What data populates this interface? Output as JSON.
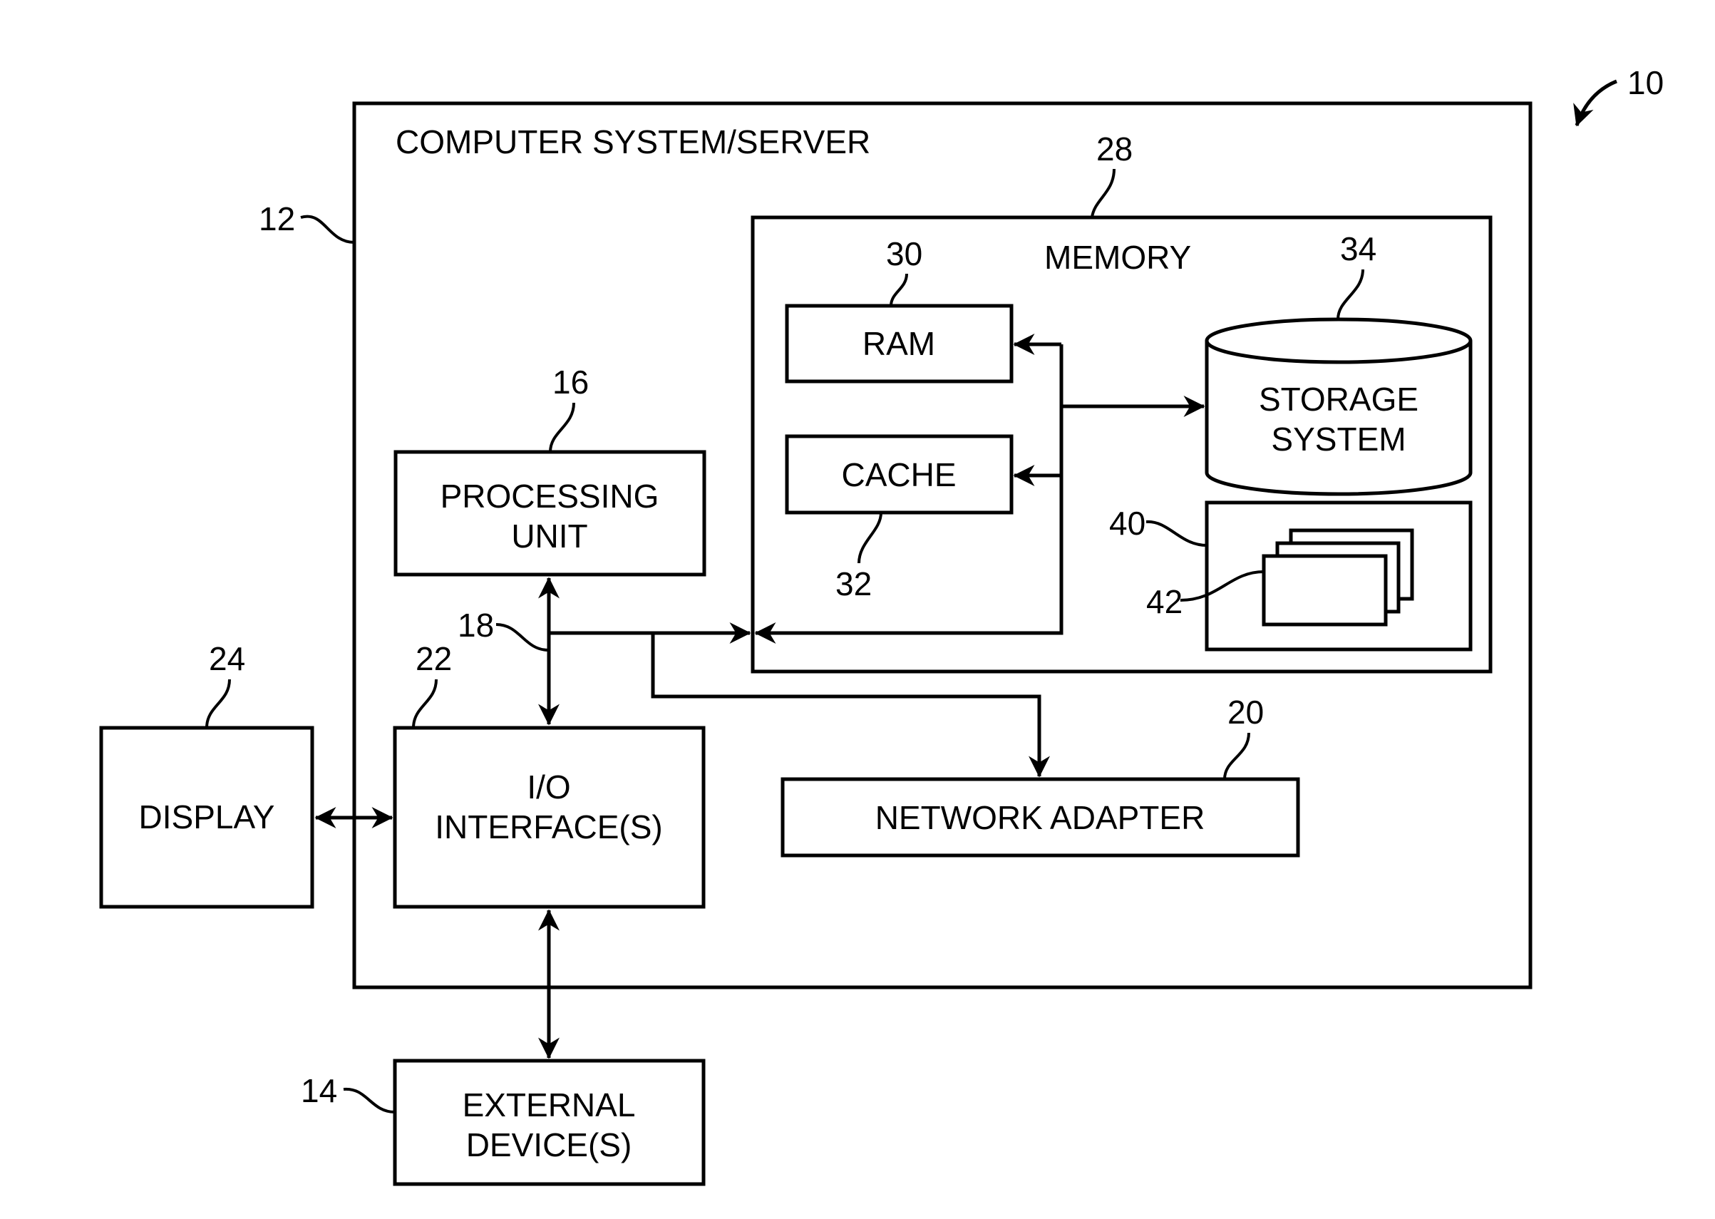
{
  "figure_ref": "10",
  "components": {
    "computer_system": {
      "ref": "12",
      "label": "COMPUTER SYSTEM/SERVER"
    },
    "memory": {
      "ref": "28",
      "label": "MEMORY"
    },
    "ram": {
      "ref": "30",
      "label": "RAM"
    },
    "cache": {
      "ref": "32",
      "label": "CACHE"
    },
    "storage": {
      "ref": "34",
      "label_lines": [
        "STORAGE",
        "SYSTEM"
      ]
    },
    "program_module_group": {
      "ref": "40"
    },
    "program_modules": {
      "ref": "42"
    },
    "processing_unit": {
      "ref": "16",
      "label_lines": [
        "PROCESSING",
        "UNIT"
      ]
    },
    "bus": {
      "ref": "18"
    },
    "network_adapter": {
      "ref": "20",
      "label": "NETWORK ADAPTER"
    },
    "io_interface": {
      "ref": "22",
      "label_lines": [
        "I/O",
        "INTERFACE(S)"
      ]
    },
    "display": {
      "ref": "24",
      "label": "DISPLAY"
    },
    "external_devices": {
      "ref": "14",
      "label_lines": [
        "EXTERNAL",
        "DEVICE(S)"
      ]
    }
  },
  "colors": {
    "stroke": "#000000",
    "background": "#ffffff"
  }
}
